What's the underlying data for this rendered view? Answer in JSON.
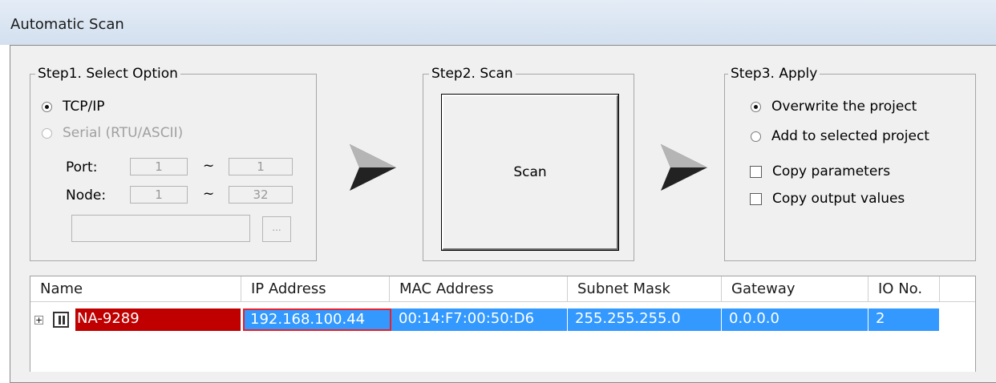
{
  "window": {
    "title": "Automatic Scan"
  },
  "step1": {
    "label": "Step1. Select Option",
    "options": [
      {
        "label": "TCP/IP",
        "selected": true,
        "enabled": true
      },
      {
        "label": "Serial (RTU/ASCII)",
        "selected": false,
        "enabled": false
      }
    ],
    "port_label": "Port:",
    "port_from": "1",
    "port_to": "1",
    "node_label": "Node:",
    "node_from": "1",
    "node_to": "32",
    "range_sep": "~",
    "path_value": "",
    "browse_label": "..."
  },
  "step2": {
    "label": "Step2. Scan",
    "scan_button": "Scan"
  },
  "step3": {
    "label": "Step3. Apply",
    "options": [
      {
        "label": "Overwrite the project",
        "selected": true
      },
      {
        "label": "Add to selected project",
        "selected": false
      }
    ],
    "checks": [
      {
        "label": "Copy parameters",
        "checked": false
      },
      {
        "label": "Copy output values",
        "checked": false
      }
    ]
  },
  "table": {
    "columns": [
      "Name",
      "IP Address",
      "MAC Address",
      "Subnet Mask",
      "Gateway",
      "IO No."
    ],
    "rows": [
      {
        "expander": "+",
        "name": "NA-9289",
        "ip": "192.168.100.44",
        "mac": "00:14:F7:00:50:D6",
        "subnet": "255.255.255.0",
        "gateway": "0.0.0.0",
        "io": "2"
      }
    ]
  },
  "colors": {
    "selection": "#3399ff",
    "name_highlight": "#c00000",
    "ip_focus_border": "#e8202a"
  },
  "icons": {
    "expander": "plus-box-icon",
    "device": "device-module-icon",
    "arrow": "play-arrow-icon"
  }
}
